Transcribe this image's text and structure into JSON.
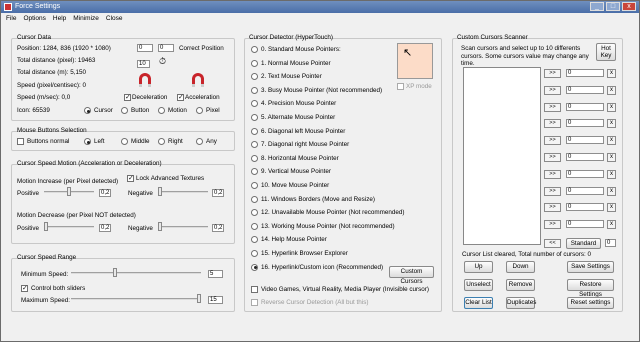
{
  "window": {
    "title": "Force Settings",
    "minimize": "_",
    "maximize": "□",
    "close": "x"
  },
  "menu": [
    "File",
    "Options",
    "Help",
    "Minimize",
    "Close"
  ],
  "cursor_data": {
    "title": "Cursor Data",
    "position_label": "Position: 1284, 836 (1920 * 1080)",
    "pos_x": "0",
    "pos_y": "0",
    "correct_position": "Correct Position",
    "total_distance_pixel": "Total distance (pixel): 19463",
    "total_distance_m": "Total distance (m): 5,150",
    "speed_pixel": "Speed (pixel/centisec): 0",
    "speed_ms": "Speed (m/sec): 0,0",
    "icon": "Icon: 65539",
    "timer_value": "10",
    "deceleration": "Deceleration",
    "acceleration": "Acceleration",
    "radio_cursor": "Cursor",
    "radio_button": "Button",
    "radio_motion": "Motion",
    "radio_pixel": "Pixel"
  },
  "mouse_buttons": {
    "title": "Mouse Buttons Selection",
    "buttons_normal": "Buttons normal",
    "left": "Left",
    "middle": "Middle",
    "right": "Right",
    "any": "Any"
  },
  "speed_motion": {
    "title": "Cursor Speed Motion (Acceleration or Deceleration)",
    "increase_label": "Motion Increase (per Pixel detected)",
    "lock_advanced": "Lock Advanced Textures",
    "positive": "Positive",
    "negative": "Negative",
    "inc_pos_value": "0,2",
    "inc_neg_value": "0,2",
    "decrease_label": "Motion Decrease (per Pixel NOT detected)",
    "dec_pos_value": "0,2",
    "dec_neg_value": "0,2",
    "slider_inc_pos": 0.5,
    "slider_inc_neg": 0.0,
    "slider_dec_pos": 0.0,
    "slider_dec_neg": 0.0
  },
  "speed_range": {
    "title": "Cursor Speed Range",
    "min_label": "Minimum Speed:",
    "min_value": "5",
    "control_both": "Control both sliders",
    "max_label": "Maximum Speed:",
    "max_value": "15",
    "slider_min": 0.33,
    "slider_max": 1.0
  },
  "detector": {
    "title": "Cursor Detector (HyperTouch)",
    "items": [
      "0. Standard Mouse Pointers:",
      "1. Normal Mouse Pointer",
      "2. Text Mouse Pointer",
      "3. Busy Mouse Pointer (Not recommended)",
      "4. Precision Mouse Pointer",
      "5. Alternate Mouse Pointer",
      "6. Diagonal left Mouse Pointer",
      "7. Diagonal right Mouse Pointer",
      "8. Horizontal Mouse Pointer",
      "9. Vertical Mouse Pointer",
      "10. Move Mouse Pointer",
      "11. Windows Borders (Move and Resize)",
      "12. Unavailable Mouse Pointer (Not recommended)",
      "13. Working Mouse Pointer (Not recommended)",
      "14. Help Mouse Pointer",
      "15. Hyperlink Browser Explorer",
      "16. Hyperlink/Custom icon (Recommended)"
    ],
    "selected_index": 16,
    "xp_mode": "XP mode",
    "custom_cursors": "Custom Cursors",
    "video_games": "Video Games, Virtual Reality, Media Player (Invisible cursor)",
    "reverse": "Reverse Cursor Detection (All but this)"
  },
  "scanner": {
    "title": "Custom Cursors Scanner",
    "description": "Scan cursors and select up to 10 differents cursors. Some cursors value may change any time.",
    "hot_key": "Hot Key",
    "add": ">>",
    "remove": "x",
    "slots": [
      "0",
      "0",
      "0",
      "0",
      "0",
      "0",
      "0",
      "0",
      "0",
      "0"
    ],
    "back": "<<",
    "standard": "Standard",
    "standard_value": "0",
    "status": "Cursor List cleared, Total number of cursors: 0",
    "up": "Up",
    "down": "Down",
    "save_settings": "Save Settings",
    "unselect": "Unselect",
    "remove_btn": "Remove",
    "restore_settings": "Restore Settings",
    "clear_list": "Clear List",
    "duplicates": "Duplicates",
    "reset_settings": "Reset settings"
  }
}
